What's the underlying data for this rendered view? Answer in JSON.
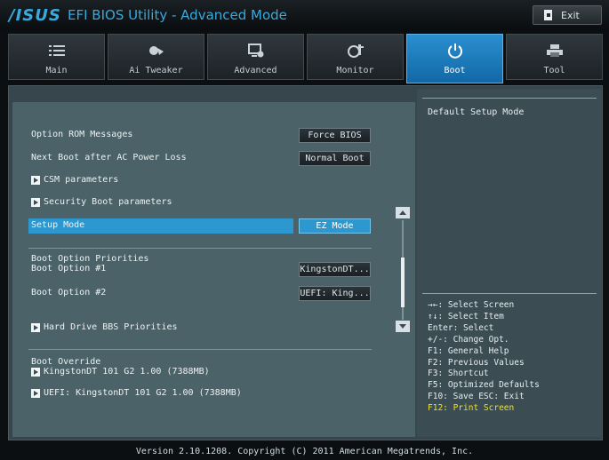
{
  "titlebar": {
    "brand": "/ISUS",
    "title": "EFI BIOS Utility - Advanced Mode",
    "exit_label": "Exit"
  },
  "tabs": [
    {
      "label": "Main",
      "icon": "list-icon"
    },
    {
      "label": "Ai Tweaker",
      "icon": "tweaker-icon"
    },
    {
      "label": "Advanced",
      "icon": "advanced-icon"
    },
    {
      "label": "Monitor",
      "icon": "monitor-icon"
    },
    {
      "label": "Boot",
      "icon": "power-icon",
      "active": true
    },
    {
      "label": "Tool",
      "icon": "printer-icon"
    }
  ],
  "settings": {
    "option_rom": {
      "label": "Option ROM Messages",
      "value": "Force BIOS"
    },
    "next_boot": {
      "label": "Next Boot after AC Power Loss",
      "value": "Normal Boot"
    },
    "csm": {
      "label": "CSM parameters"
    },
    "security": {
      "label": "Security Boot parameters"
    },
    "setup_mode": {
      "label": "Setup Mode",
      "value": "EZ Mode"
    },
    "priorities_heading": "Boot Option Priorities",
    "boot1": {
      "label": "Boot Option #1",
      "value": "KingstonDT..."
    },
    "boot2": {
      "label": "Boot Option #2",
      "value": "UEFI: King..."
    },
    "hdd_bbs": {
      "label": "Hard Drive BBS Priorities"
    },
    "override_heading": "Boot Override",
    "override1": "KingstonDT 101 G2 1.00  (7388MB)",
    "override2": "UEFI: KingstonDT 101 G2 1.00  (7388MB)"
  },
  "help_text": "Default Setup Mode",
  "keys": [
    "→←: Select Screen",
    "↑↓: Select Item",
    "Enter: Select",
    "+/-: Change Opt.",
    "F1: General Help",
    "F2: Previous Values",
    "F3: Shortcut",
    "F5: Optimized Defaults",
    "F10: Save  ESC: Exit",
    "F12: Print Screen"
  ],
  "footer": "Version 2.10.1208. Copyright (C) 2011 American Megatrends, Inc.",
  "colors": {
    "accent": "#2d98cf",
    "brand": "#3aa9de",
    "highlight_key": "#f4e21c"
  }
}
